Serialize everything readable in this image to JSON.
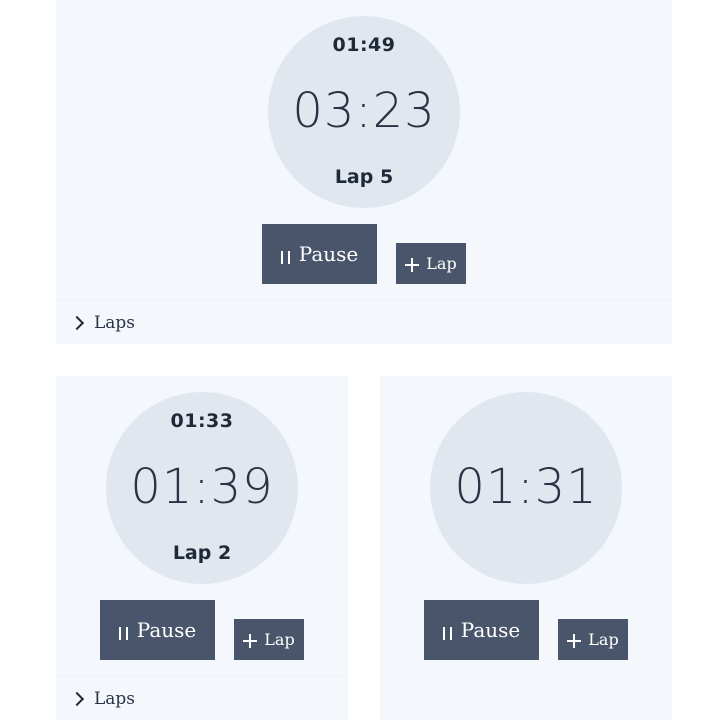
{
  "timers": [
    {
      "lap_time": "01:49",
      "main_time": "03:23",
      "lap_label": "Lap 5",
      "pause_label": "Pause",
      "lap_button_label": "Lap",
      "laps_toggle_label": "Laps"
    },
    {
      "lap_time": "01:33",
      "main_time": "01:39",
      "lap_label": "Lap 2",
      "pause_label": "Pause",
      "lap_button_label": "Lap",
      "laps_toggle_label": "Laps"
    },
    {
      "main_time": "01:31",
      "pause_label": "Pause",
      "lap_button_label": "Lap"
    }
  ],
  "colors": {
    "card_background": "#f4f7fb",
    "dial_background": "#e1e7ef",
    "button_background": "#48556a",
    "text": "#2a3345"
  },
  "icons": {
    "pause": "pause-icon",
    "add": "plus-icon",
    "expand": "chevron-right-icon"
  }
}
